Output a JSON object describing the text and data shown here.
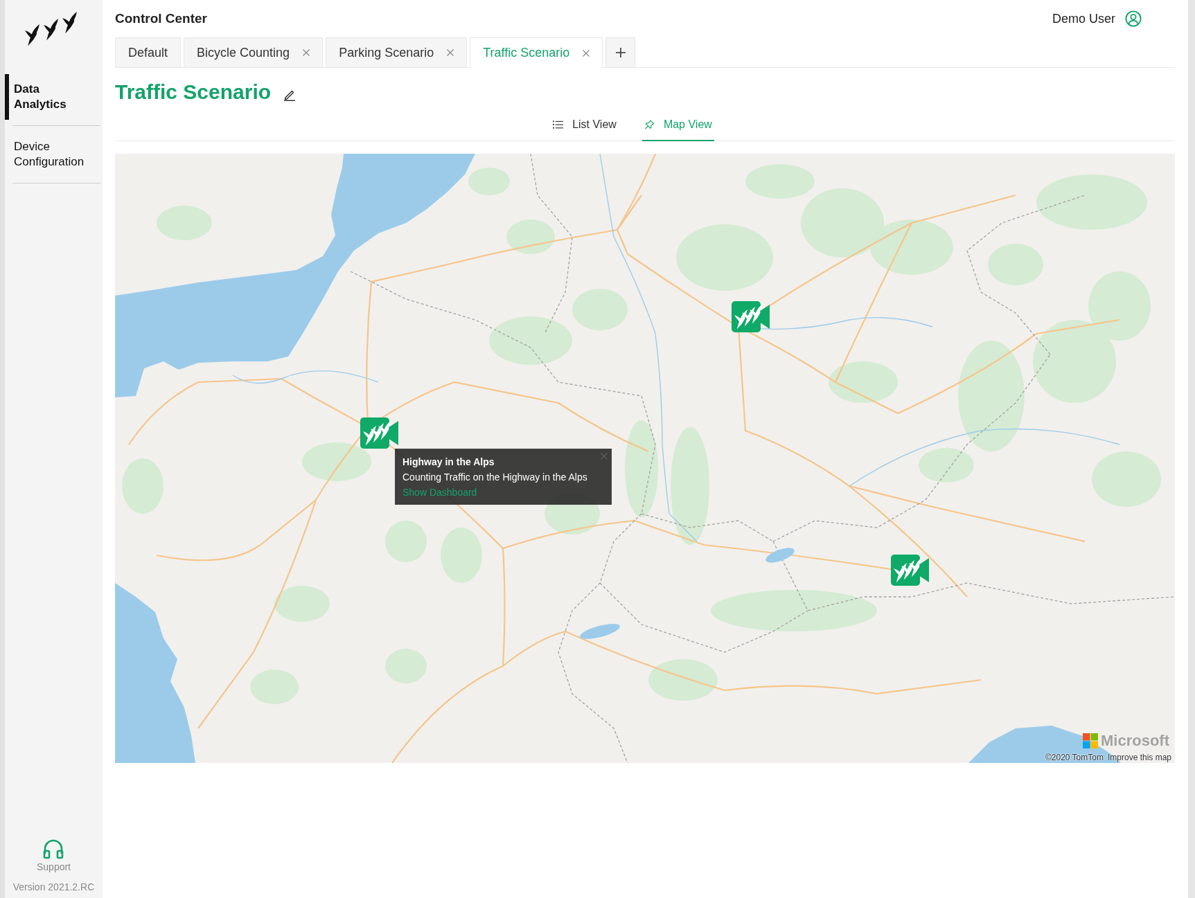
{
  "sidebar": {
    "items": [
      {
        "label": "Data Analytics",
        "selected": true
      },
      {
        "label": "Device Configuration",
        "selected": false
      }
    ],
    "support": "Support",
    "version": "Version 2021.2.RC"
  },
  "header": {
    "title": "Control Center",
    "user": "Demo User"
  },
  "tabs": [
    {
      "label": "Default",
      "selected": false,
      "closable": false
    },
    {
      "label": "Bicycle Counting",
      "selected": false,
      "closable": true
    },
    {
      "label": "Parking Scenario",
      "selected": false,
      "closable": true
    },
    {
      "label": "Traffic Scenario",
      "selected": true,
      "closable": true
    }
  ],
  "page": {
    "title": "Traffic Scenario"
  },
  "views": [
    {
      "label": "List View",
      "kind": "list",
      "selected": false
    },
    {
      "label": "Map View",
      "kind": "map",
      "selected": true
    }
  ],
  "map": {
    "popup": {
      "title": "Highway in the Alps",
      "description": "Counting Traffic on the Highway in the Alps",
      "link": "Show Dashboard"
    },
    "logo": "Microsoft",
    "attribution": "©2020 TomTom",
    "improve_link": "Improve this map"
  }
}
